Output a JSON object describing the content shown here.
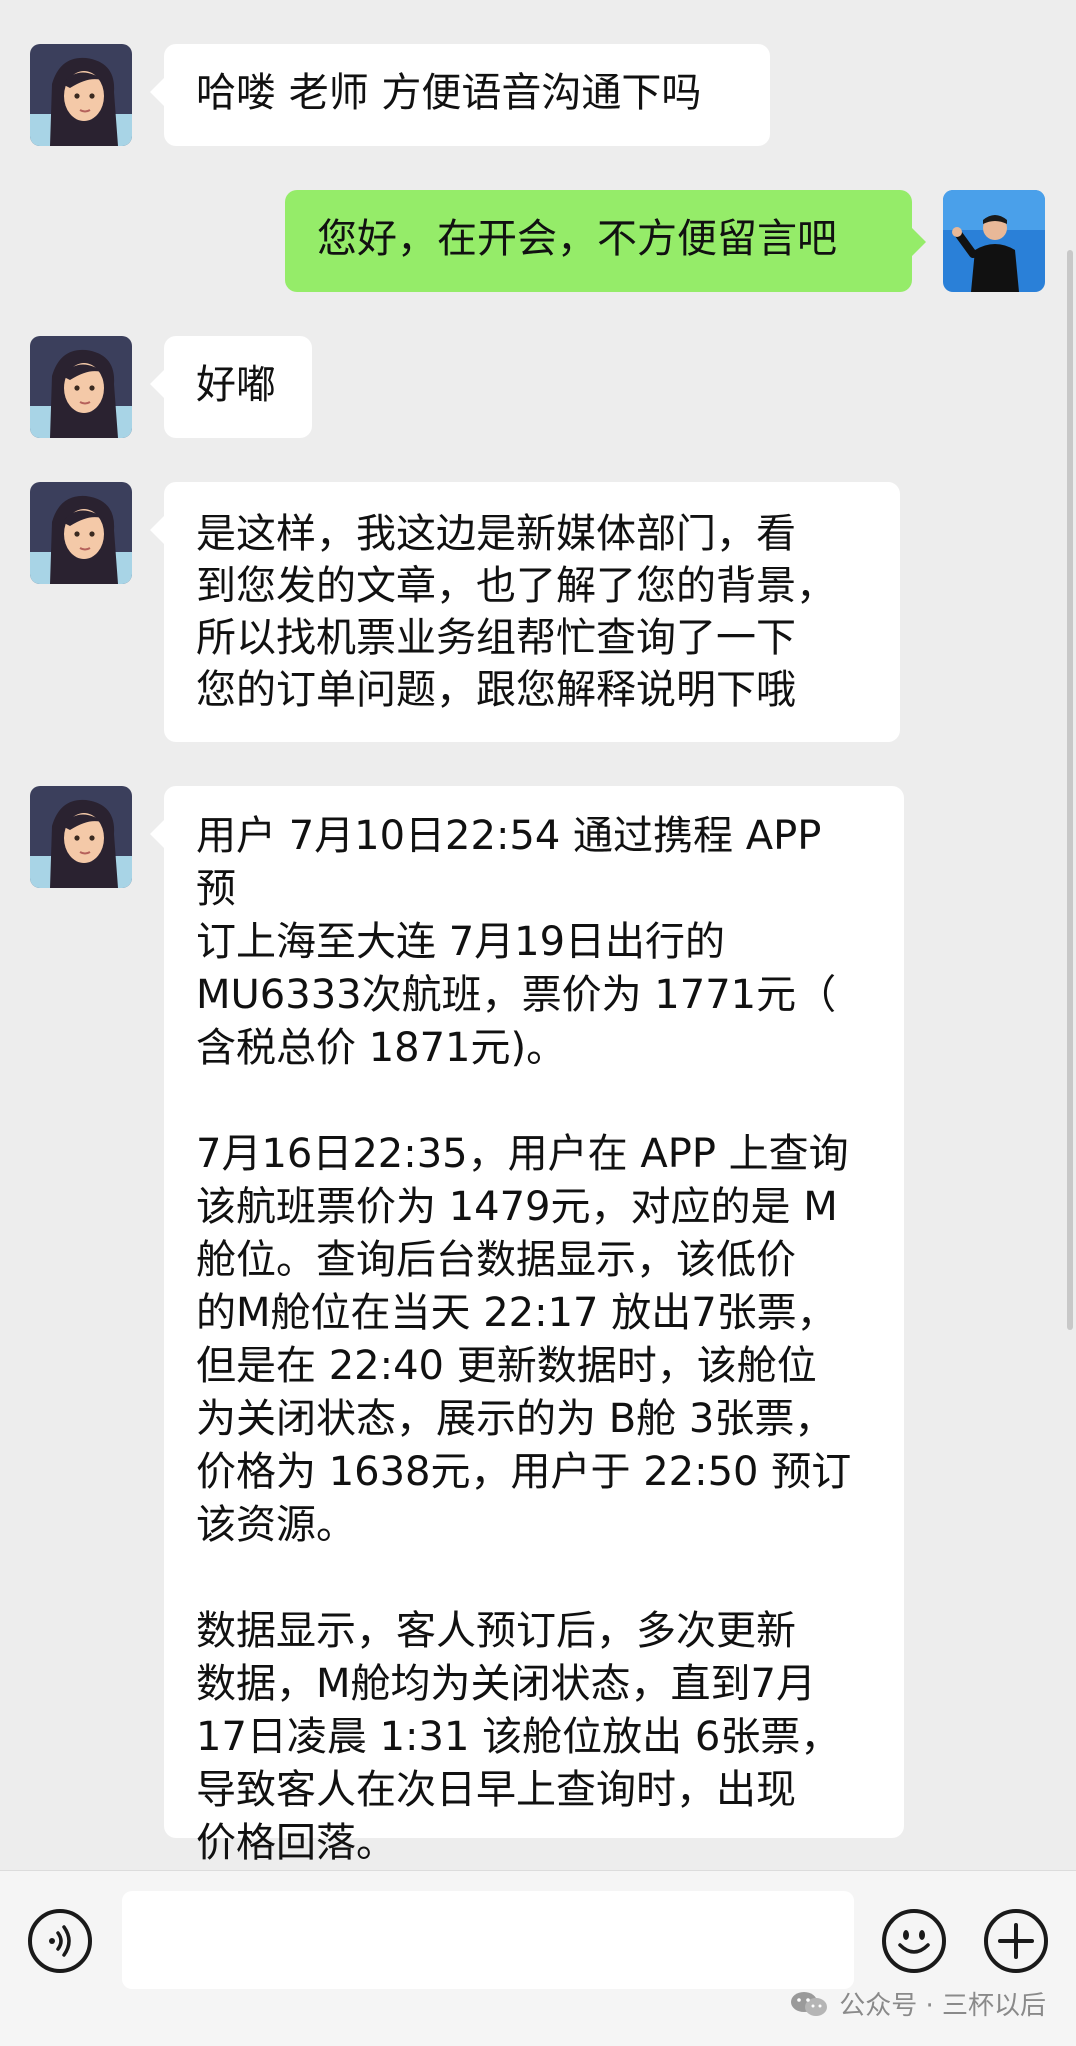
{
  "messages": [
    {
      "side": "left",
      "sender": "teacher",
      "text": "哈喽 老师 方便语音沟通下吗"
    },
    {
      "side": "right",
      "sender": "me",
      "text": "您好，在开会，不方便留言吧"
    },
    {
      "side": "left",
      "sender": "teacher",
      "text": "好嘟"
    },
    {
      "side": "left",
      "sender": "teacher",
      "lines": [
        "是这样，我这边是新媒体部门，看",
        "到您发的文章，也了解了您的背景，",
        "所以找机票业务组帮忙查询了一下",
        "您的订单问题，跟您解释说明下哦"
      ]
    },
    {
      "side": "left",
      "sender": "teacher",
      "paragraphs": [
        [
          "用户 7月10日22:54 通过携程 APP 预",
          "订上海至大连 7月19日出行的",
          "MU6333次航班，票价为 1771元（",
          "含税总价 1871元)。"
        ],
        [
          "7月16日22:35，用户在 APP 上查询",
          "该航班票价为 1479元，对应的是 M",
          "舱位。查询后台数据显示，该低价",
          "的M舱位在当天 22:17 放出7张票，",
          "但是在 22:40 更新数据时，该舱位",
          "为关闭状态，展示的为 B舱 3张票，",
          "价格为 1638元，用户于 22:50 预订",
          "该资源。"
        ],
        [
          "数据显示，客人预订后，多次更新",
          "数据，M舱均为关闭状态，直到7月",
          "17日凌晨 1:31 该舱位放出 6张票，",
          "导致客人在次日早上查询时，出现",
          "价格回落。"
        ]
      ]
    }
  ],
  "input_bar": {
    "voice_icon": "voice-icon",
    "emoji_icon": "emoji-icon",
    "plus_icon": "plus-icon",
    "input_value": ""
  },
  "watermark": {
    "text": "公众号 · 三杯以后"
  },
  "colors": {
    "background": "#ededed",
    "left_bubble": "#ffffff",
    "right_bubble": "#95ec69"
  }
}
